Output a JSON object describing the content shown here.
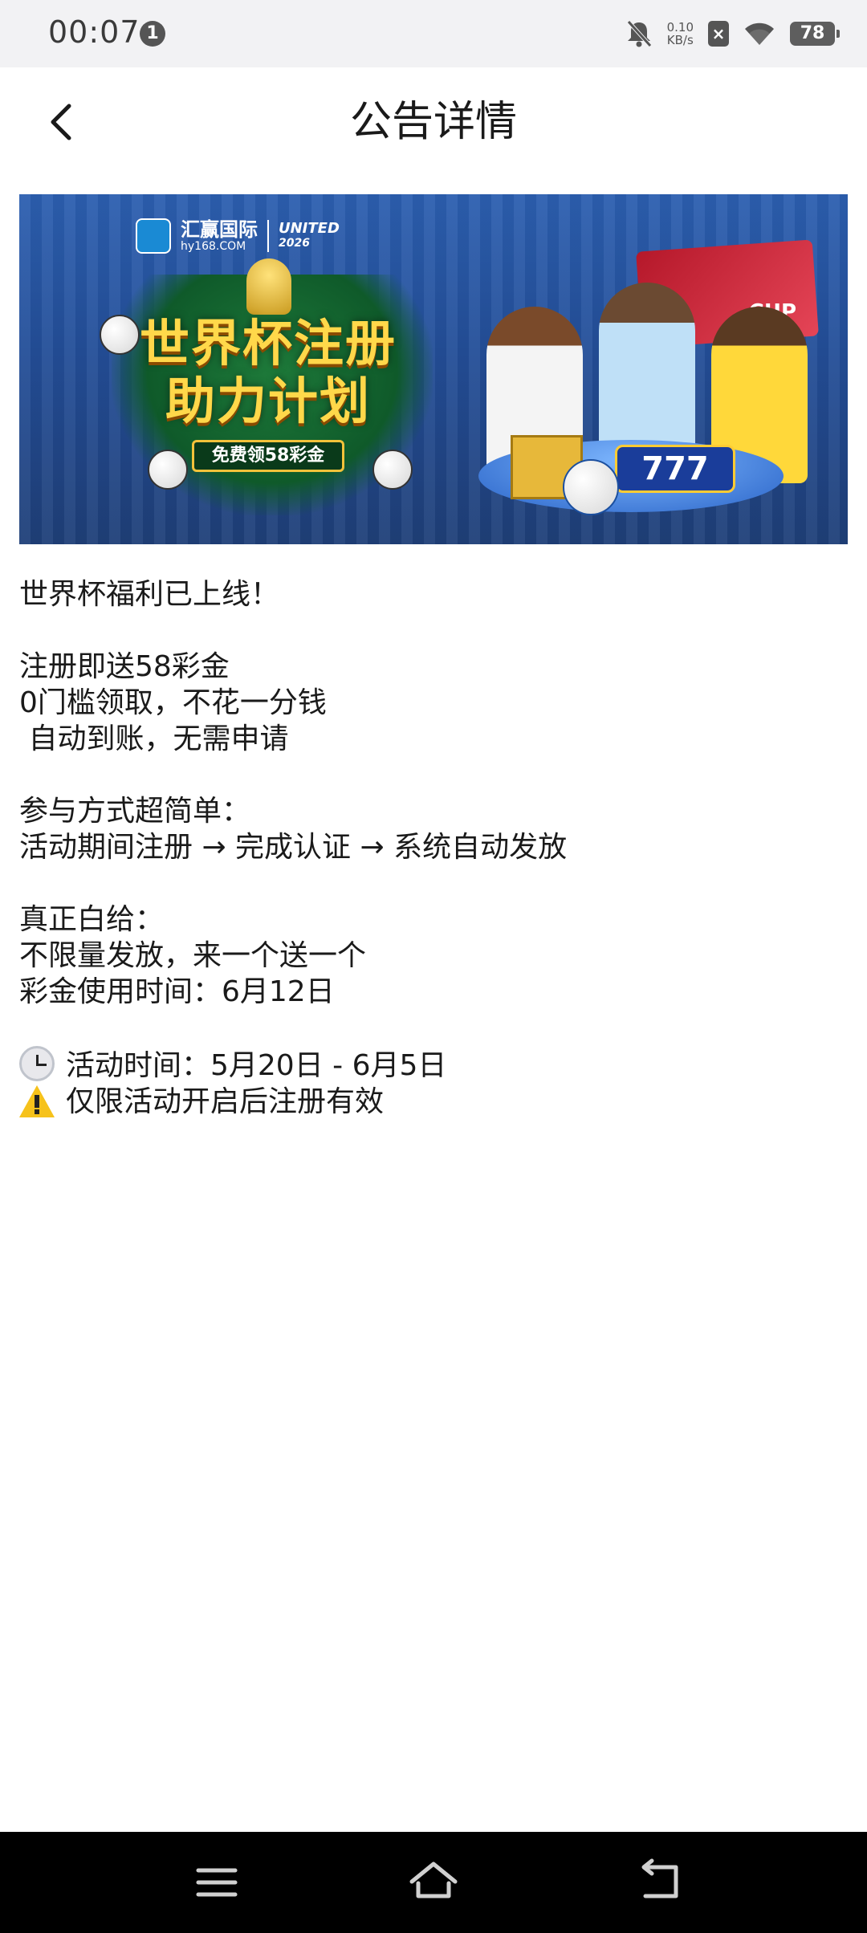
{
  "status_bar": {
    "time": "00:07",
    "notification_count": "1",
    "net_speed_value": "0.10",
    "net_speed_unit": "KB/s",
    "battery": "78"
  },
  "header": {
    "title": "公告详情"
  },
  "banner": {
    "brand_cn": "汇赢国际",
    "brand_url": "hy168.COM",
    "united": "UNITED",
    "united_year": "2026",
    "title_line1": "世界杯注册",
    "title_line2": "助力计划",
    "subtitle": "免费领58彩金",
    "cup_text": "CUP",
    "slot_text": "777"
  },
  "content": {
    "lines": [
      "世界杯福利已上线！",
      "",
      "注册即送58彩金",
      "0门槛领取，不花一分钱",
      " 自动到账，无需申请",
      "",
      "参与方式超简单：",
      "活动期间注册 → 完成认证 → 系统自动发放",
      "",
      "真正白给：",
      "不限量发放，来一个送一个",
      "彩金使用时间：6月12日",
      ""
    ],
    "activity_time": "活动时间：5月20日 - 6月5日",
    "notice": "仅限活动开启后注册有效"
  },
  "icons": {
    "activity_icon": "alarm-clock-icon",
    "notice_icon": "warning-icon"
  }
}
